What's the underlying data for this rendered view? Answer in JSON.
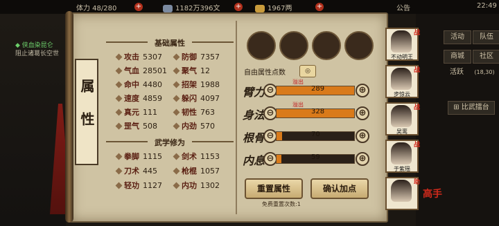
{
  "topbar": {
    "stat1": "体力 48/280",
    "stat2": "1182万396文",
    "stat3": "1967两",
    "announcement": "公告",
    "time": "22:49",
    "plus": "+"
  },
  "quest": {
    "title": "侠血染昆仑",
    "desc": "阻止诸葛长空世"
  },
  "right_menu": [
    "活动",
    "队伍",
    "商城",
    "社区",
    "活跃",
    "(18,30)",
    "比武擂台"
  ],
  "scroll_title": "属性",
  "sections": {
    "base": "基础属性",
    "martial": "武学修为"
  },
  "base_attrs": [
    {
      "name": "攻击",
      "value": "5307"
    },
    {
      "name": "防御",
      "value": "7357"
    },
    {
      "name": "气血",
      "value": "28501"
    },
    {
      "name": "聚气",
      "value": "12"
    },
    {
      "name": "命中",
      "value": "4480"
    },
    {
      "name": "招架",
      "value": "1988"
    },
    {
      "name": "速度",
      "value": "4859"
    },
    {
      "name": "躲闪",
      "value": "4097"
    },
    {
      "name": "真元",
      "value": "111"
    },
    {
      "name": "韧性",
      "value": "763"
    },
    {
      "name": "罡气",
      "value": "508"
    },
    {
      "name": "内劲",
      "value": "570"
    }
  ],
  "martial_attrs": [
    {
      "name": "拳脚",
      "value": "1115"
    },
    {
      "name": "剑术",
      "value": "1153"
    },
    {
      "name": "刀术",
      "value": "445"
    },
    {
      "name": "枪棍",
      "value": "1057"
    },
    {
      "name": "轻功",
      "value": "1127"
    },
    {
      "name": "内功",
      "value": "1302"
    }
  ],
  "free_points": {
    "label": "自由属性点数",
    "value": "◎"
  },
  "allocation": [
    {
      "label": "臂力",
      "value": "289",
      "fill": 1.0,
      "overflow": "溢出"
    },
    {
      "label": "身法",
      "value": "328",
      "fill": 1.0,
      "overflow": "溢出"
    },
    {
      "label": "根骨",
      "value": "70",
      "fill": 0.07,
      "overflow": ""
    },
    {
      "label": "内息",
      "value": "59",
      "fill": 0.06,
      "overflow": ""
    }
  ],
  "buttons": {
    "reset": "重置属性",
    "confirm": "确认加点",
    "reset_note": "免费重置次数:1",
    "minus": "⊖",
    "plus": "⊕"
  },
  "heroes": [
    {
      "name": "不动明王",
      "tag": "战"
    },
    {
      "name": "步惊云",
      "tag": "战"
    },
    {
      "name": "吴鸾",
      "tag": "战"
    },
    {
      "name": "于紫瑶",
      "tag": "战"
    },
    {
      "name": "",
      "tag": "助"
    }
  ],
  "side_tag": "高手",
  "colors": {
    "accent_red": "#b0301c",
    "bar_fill": "#d97a1a",
    "parchment": "#cfc3a3"
  }
}
